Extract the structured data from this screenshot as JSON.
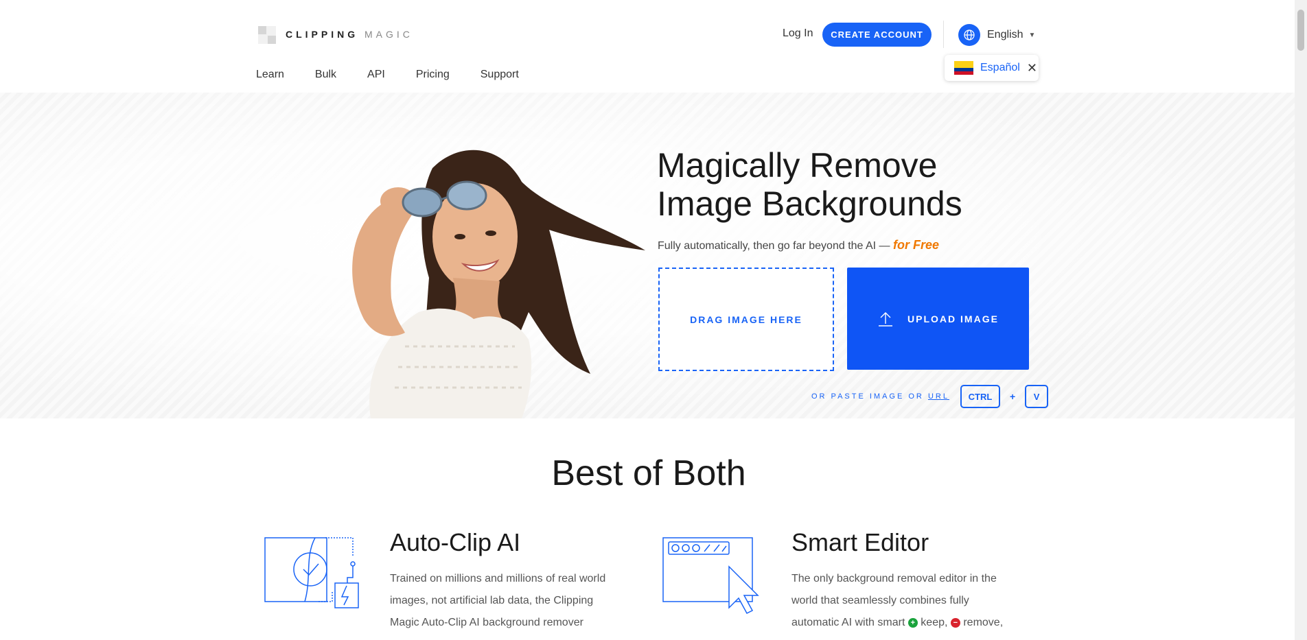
{
  "header": {
    "logo_bold": "CLIPPING",
    "logo_light": "MAGIC",
    "nav": [
      "Learn",
      "Bulk",
      "API",
      "Pricing",
      "Support"
    ],
    "login": "Log In",
    "create_account": "CREATE ACCOUNT",
    "language": "English",
    "language_suggestion": "Español"
  },
  "hero": {
    "title_line1": "Magically Remove",
    "title_line2": "Image Backgrounds",
    "subtitle": "Fully automatically, then go far beyond the AI —",
    "subtitle_free": "for Free",
    "drag_label": "DRAG IMAGE HERE",
    "upload_label": "UPLOAD IMAGE",
    "paste_prefix": "OR PASTE IMAGE OR",
    "paste_url": "URL",
    "key_ctrl": "CTRL",
    "key_plus": "+",
    "key_v": "V"
  },
  "section": {
    "title": "Best of Both",
    "features": [
      {
        "title": "Auto-Clip AI",
        "text": "Trained on millions and millions of real world images, not artificial lab data, the Clipping Magic Auto-Clip AI background remover"
      },
      {
        "title": "Smart Editor",
        "text_a": "The only background removal editor in the world that seamlessly combines fully automatic AI with smart",
        "text_keep": "keep,",
        "text_remove": "remove,"
      }
    ]
  },
  "colors": {
    "accent": "#1863f6",
    "free": "#f07800"
  }
}
